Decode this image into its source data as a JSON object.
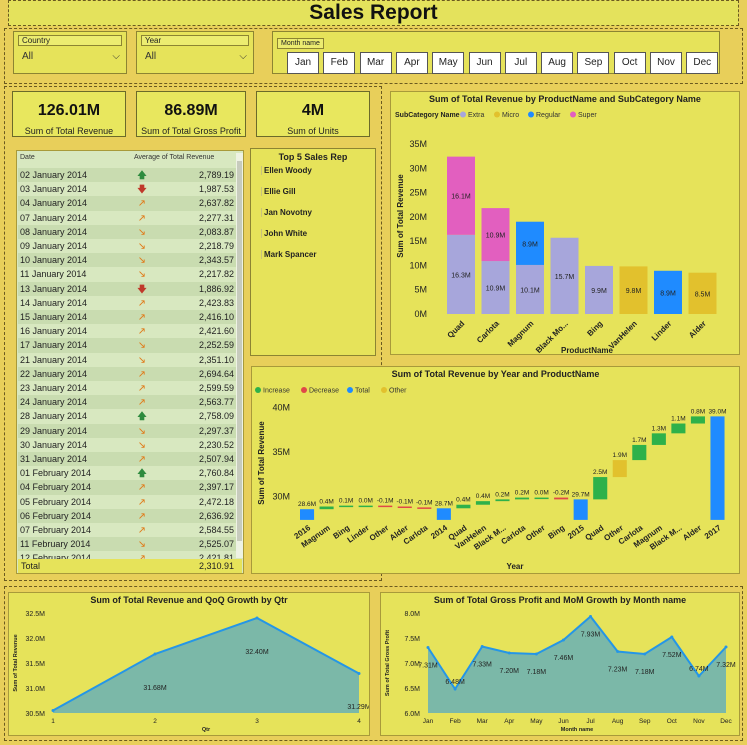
{
  "title": "Sales Report",
  "slicers": {
    "country": {
      "label": "Country",
      "value": "All"
    },
    "year": {
      "label": "Year",
      "value": "All"
    },
    "month": {
      "label": "Month name",
      "options": [
        "Jan",
        "Feb",
        "Mar",
        "Apr",
        "May",
        "Jun",
        "Jul",
        "Aug",
        "Sep",
        "Oct",
        "Nov",
        "Dec"
      ]
    }
  },
  "kpis": [
    {
      "value": "126.01M",
      "label": "Sum of Total Revenue"
    },
    {
      "value": "86.89M",
      "label": "Sum of Total Gross Profit"
    },
    {
      "value": "4M",
      "label": "Sum of Units"
    }
  ],
  "table": {
    "col_date": "Date",
    "col_avg": "Average of Total Revenue",
    "rows": [
      {
        "date": "02 January 2014",
        "trend": "up",
        "value": "2,789.19"
      },
      {
        "date": "03 January 2014",
        "trend": "down",
        "value": "1,987.53"
      },
      {
        "date": "04 January 2014",
        "trend": "upright",
        "value": "2,637.82"
      },
      {
        "date": "07 January 2014",
        "trend": "upright",
        "value": "2,277.31"
      },
      {
        "date": "08 January 2014",
        "trend": "downright",
        "value": "2,083.87"
      },
      {
        "date": "09 January 2014",
        "trend": "downright",
        "value": "2,218.79"
      },
      {
        "date": "10 January 2014",
        "trend": "downright",
        "value": "2,343.57"
      },
      {
        "date": "11 January 2014",
        "trend": "downright",
        "value": "2,217.82"
      },
      {
        "date": "13 January 2014",
        "trend": "down",
        "value": "1,886.92"
      },
      {
        "date": "14 January 2014",
        "trend": "upright",
        "value": "2,423.83"
      },
      {
        "date": "15 January 2014",
        "trend": "upright",
        "value": "2,416.10"
      },
      {
        "date": "16 January 2014",
        "trend": "upright",
        "value": "2,421.60"
      },
      {
        "date": "17 January 2014",
        "trend": "downright",
        "value": "2,252.59"
      },
      {
        "date": "21 January 2014",
        "trend": "downright",
        "value": "2,351.10"
      },
      {
        "date": "22 January 2014",
        "trend": "upright",
        "value": "2,694.64"
      },
      {
        "date": "23 January 2014",
        "trend": "upright",
        "value": "2,599.59"
      },
      {
        "date": "24 January 2014",
        "trend": "upright",
        "value": "2,563.77"
      },
      {
        "date": "28 January 2014",
        "trend": "up",
        "value": "2,758.09"
      },
      {
        "date": "29 January 2014",
        "trend": "downright",
        "value": "2,297.37"
      },
      {
        "date": "30 January 2014",
        "trend": "downright",
        "value": "2,230.52"
      },
      {
        "date": "31 January 2014",
        "trend": "upright",
        "value": "2,507.94"
      },
      {
        "date": "01 February 2014",
        "trend": "up",
        "value": "2,760.84"
      },
      {
        "date": "04 February 2014",
        "trend": "upright",
        "value": "2,397.17"
      },
      {
        "date": "05 February 2014",
        "trend": "upright",
        "value": "2,472.18"
      },
      {
        "date": "06 February 2014",
        "trend": "upright",
        "value": "2,636.92"
      },
      {
        "date": "07 February 2014",
        "trend": "upright",
        "value": "2,584.55"
      },
      {
        "date": "11 February 2014",
        "trend": "downright",
        "value": "2,525.07"
      },
      {
        "date": "12 February 2014",
        "trend": "upright",
        "value": "2,421.81"
      }
    ],
    "total_label": "Total",
    "total_value": "2,310.91"
  },
  "top5": {
    "title": "Top 5 Sales Rep",
    "names": [
      "Ellen Woody",
      "Ellie Gill",
      "Jan Novotny",
      "John White",
      "Mark Spancer"
    ]
  },
  "colors": {
    "extra": "#a7a6db",
    "micro": "#e2c12d",
    "regular": "#1f8bff",
    "super": "#e25fbf",
    "increase": "#2eb14a",
    "decrease": "#e04848",
    "total": "#1f8bff",
    "other": "#e2c12d",
    "area": "#7bb8a8",
    "line": "#2596e6"
  },
  "chart_data": [
    {
      "type": "bar",
      "title": "Sum of Total Revenue by ProductName and SubCategory Name",
      "xlabel": "ProductName",
      "ylabel": "Sum of Total Revenue",
      "legend_title": "SubCategory Name",
      "legend": [
        "Extra",
        "Micro",
        "Regular",
        "Super"
      ],
      "yticks": [
        "0M",
        "5M",
        "10M",
        "15M",
        "20M",
        "25M",
        "30M",
        "35M"
      ],
      "ylim": [
        0,
        35
      ],
      "categories": [
        "Quad",
        "Carlota",
        "Magnum",
        "Black Mo...",
        "Bing",
        "VanHelen",
        "Linder",
        "Alder"
      ],
      "stacks": [
        [
          {
            "s": "Extra",
            "v": 16.3,
            "label": "16.3M"
          },
          {
            "s": "Super",
            "v": 16.1,
            "label": "16.1M"
          }
        ],
        [
          {
            "s": "Extra",
            "v": 10.9,
            "label": "10.9M"
          },
          {
            "s": "Super",
            "v": 10.9,
            "label": "10.9M"
          }
        ],
        [
          {
            "s": "Extra",
            "v": 10.1,
            "label": "10.1M"
          },
          {
            "s": "Regular",
            "v": 8.9,
            "label": "8.9M"
          }
        ],
        [
          {
            "s": "Extra",
            "v": 15.7,
            "label": "15.7M"
          }
        ],
        [
          {
            "s": "Extra",
            "v": 9.9,
            "label": "9.9M"
          }
        ],
        [
          {
            "s": "Micro",
            "v": 9.8,
            "label": "9.8M"
          }
        ],
        [
          {
            "s": "Regular",
            "v": 8.9,
            "label": "8.9M"
          }
        ],
        [
          {
            "s": "Micro",
            "v": 8.5,
            "label": "8.5M"
          }
        ]
      ]
    },
    {
      "type": "waterfall",
      "title": "Sum of Total Revenue by Year and ProductName",
      "xlabel": "Year",
      "ylabel": "Sum of Total Revenue",
      "legend": [
        "Increase",
        "Decrease",
        "Total",
        "Other"
      ],
      "yticks": [
        "30M",
        "35M",
        "40M"
      ],
      "ylim": [
        27.5,
        40.5
      ],
      "steps": [
        {
          "cat": "2016",
          "kind": "Total",
          "start": 27.4,
          "end": 28.6,
          "label": "28.6M"
        },
        {
          "cat": "Magnum",
          "kind": "Increase",
          "start": 28.6,
          "end": 28.9,
          "label": "0.4M"
        },
        {
          "cat": "Bing",
          "kind": "Increase",
          "start": 28.9,
          "end": 29.0,
          "label": "0.1M"
        },
        {
          "cat": "Linder",
          "kind": "Increase",
          "start": 29.0,
          "end": 29.0,
          "label": "0.0M"
        },
        {
          "cat": "Other",
          "kind": "Decrease",
          "start": 29.0,
          "end": 28.9,
          "label": "-0.1M"
        },
        {
          "cat": "Alder",
          "kind": "Decrease",
          "start": 28.9,
          "end": 28.8,
          "label": "-0.1M"
        },
        {
          "cat": "Carlota",
          "kind": "Decrease",
          "start": 28.8,
          "end": 28.7,
          "label": "-0.1M"
        },
        {
          "cat": "2014",
          "kind": "Total",
          "start": 27.4,
          "end": 28.7,
          "label": "28.7M"
        },
        {
          "cat": "Quad",
          "kind": "Increase",
          "start": 28.7,
          "end": 29.1,
          "label": "0.4M"
        },
        {
          "cat": "VanHelen",
          "kind": "Increase",
          "start": 29.1,
          "end": 29.5,
          "label": "0.4M"
        },
        {
          "cat": "Black M...",
          "kind": "Increase",
          "start": 29.5,
          "end": 29.7,
          "label": "0.2M"
        },
        {
          "cat": "Carlota",
          "kind": "Increase",
          "start": 29.7,
          "end": 29.9,
          "label": "0.2M"
        },
        {
          "cat": "Other",
          "kind": "Increase",
          "start": 29.9,
          "end": 29.9,
          "label": "0.0M"
        },
        {
          "cat": "Bing",
          "kind": "Decrease",
          "start": 29.9,
          "end": 29.7,
          "label": "-0.2M"
        },
        {
          "cat": "2015",
          "kind": "Total",
          "start": 27.4,
          "end": 29.7,
          "label": "29.7M"
        },
        {
          "cat": "Quad",
          "kind": "Increase",
          "start": 29.7,
          "end": 32.2,
          "label": "2.5M"
        },
        {
          "cat": "Other",
          "kind": "Other",
          "start": 32.2,
          "end": 34.1,
          "label": "1.9M"
        },
        {
          "cat": "Carlota",
          "kind": "Increase",
          "start": 34.1,
          "end": 35.8,
          "label": "1.7M"
        },
        {
          "cat": "Magnum",
          "kind": "Increase",
          "start": 35.8,
          "end": 37.1,
          "label": "1.3M"
        },
        {
          "cat": "Black M...",
          "kind": "Increase",
          "start": 37.1,
          "end": 38.2,
          "label": "1.1M"
        },
        {
          "cat": "Alder",
          "kind": "Increase",
          "start": 38.2,
          "end": 39.0,
          "label": "0.8M"
        },
        {
          "cat": "2017",
          "kind": "Total",
          "start": 27.4,
          "end": 39.0,
          "label": "39.0M"
        }
      ]
    },
    {
      "type": "area",
      "title": "Sum of Total Revenue and QoQ Growth by Qtr",
      "xlabel": "Qtr",
      "ylabel": "Sum of Total Revenue",
      "x": [
        "1",
        "2",
        "3",
        "4"
      ],
      "values": [
        30.55,
        31.68,
        32.4,
        31.29
      ],
      "labels": [
        "",
        "31.68M",
        "32.40M",
        "31.29M"
      ],
      "yticks": [
        "30.5M",
        "31.0M",
        "31.5M",
        "32.0M",
        "32.5M"
      ],
      "ylim": [
        30.5,
        32.5
      ]
    },
    {
      "type": "area",
      "title": "Sum of Total Gross Profit and MoM Growth by Month name",
      "xlabel": "Month name",
      "ylabel": "Sum of Total Gross Profit",
      "x": [
        "Jan",
        "Feb",
        "Mar",
        "Apr",
        "May",
        "Jun",
        "Jul",
        "Aug",
        "Sep",
        "Oct",
        "Nov",
        "Dec"
      ],
      "values": [
        7.31,
        6.48,
        7.33,
        7.2,
        7.18,
        7.46,
        7.93,
        7.23,
        7.18,
        7.52,
        6.74,
        7.32
      ],
      "labels": [
        "7.31M",
        "6.48M",
        "7.33M",
        "7.20M",
        "7.18M",
        "7.46M",
        "7.93M",
        "7.23M",
        "7.18M",
        "7.52M",
        "6.74M",
        "7.32M"
      ],
      "yticks": [
        "6.0M",
        "6.5M",
        "7.0M",
        "7.5M",
        "8.0M"
      ],
      "ylim": [
        6.0,
        8.0
      ]
    }
  ]
}
